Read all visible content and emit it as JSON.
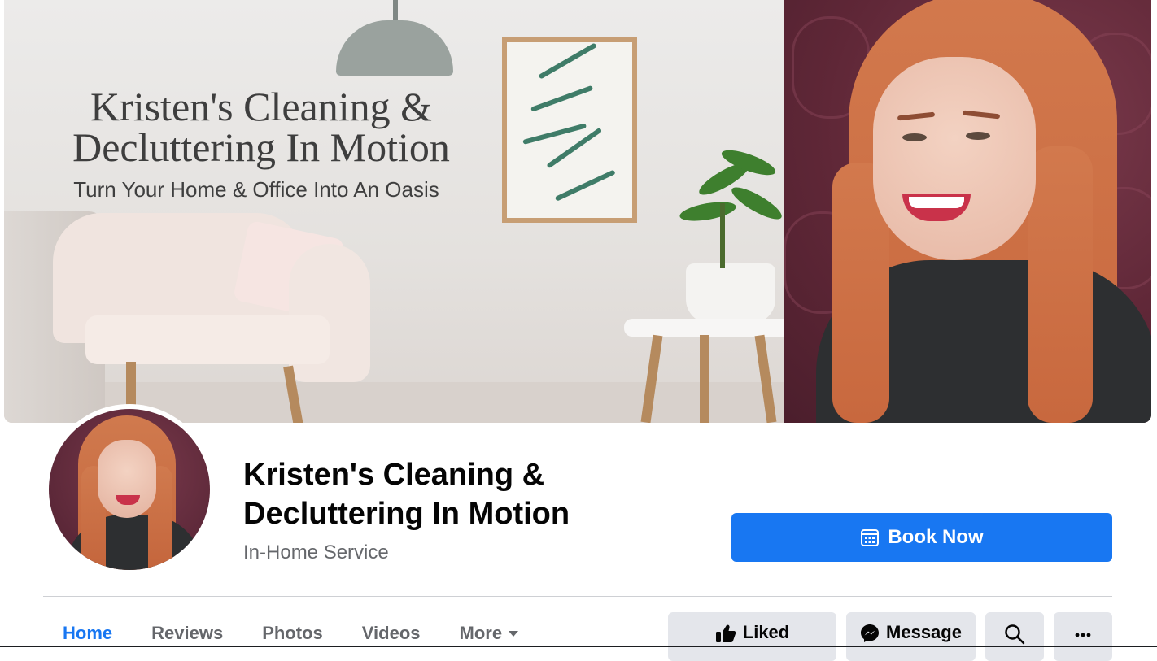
{
  "cover": {
    "headline": "Kristen's Cleaning & Decluttering In Motion",
    "tagline": "Turn Your Home & Office Into An Oasis"
  },
  "profile": {
    "page_name": "Kristen's Cleaning & Decluttering In Motion",
    "category": "In-Home Service"
  },
  "cta": {
    "label": "Book Now",
    "icon": "calendar-icon",
    "color": "#1877f2"
  },
  "tabs": [
    {
      "label": "Home",
      "active": true
    },
    {
      "label": "Reviews"
    },
    {
      "label": "Photos"
    },
    {
      "label": "Videos"
    },
    {
      "label": "More",
      "icon": "caret-down-icon"
    }
  ],
  "actions": {
    "liked": {
      "label": "Liked",
      "icon": "thumbs-up-icon"
    },
    "message": {
      "label": "Message",
      "icon": "messenger-icon"
    },
    "search": {
      "icon": "search-icon"
    },
    "more": {
      "icon": "more-dots-icon"
    }
  }
}
